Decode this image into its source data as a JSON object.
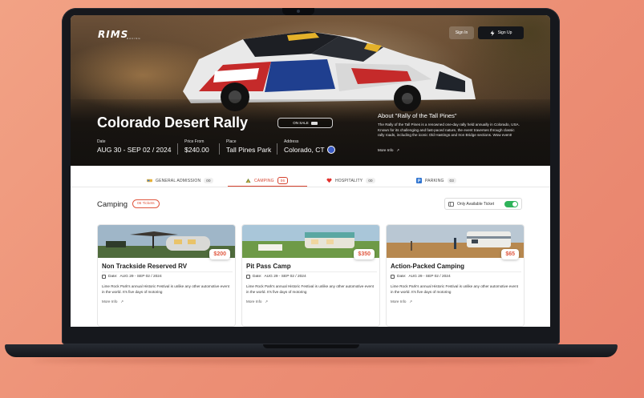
{
  "header": {
    "logo_text": "RIMS",
    "logo_sub": "RACING",
    "signin_label": "Sign In",
    "signup_label": "Sign Up"
  },
  "event": {
    "title": "Colorado Desert Rally",
    "status_badge": "ON SALE",
    "date_label": "Date",
    "date_value": "AUG 30 - SEP 02 / 2024",
    "price_label": "Price From",
    "price_value": "$240.00",
    "place_label": "Place",
    "place_value": "Tall Pines Park",
    "address_label": "Address",
    "address_value": "Colorado, CT"
  },
  "about": {
    "title": "About \"Rally of the Tall Pines\"",
    "text": "The Rally of the Tall Pines is a renowned one-day rally held annually in Colorado, USA. Known for its challenging and fast-paced nature, the event traverses through classic rally roads, including the iconic Old Hastings and Iron Bridge sections. Wow event!",
    "more_label": "More Info"
  },
  "tabs": [
    {
      "label": "GENERAL ADMISSION",
      "count": "00",
      "icon": "ticket-icon"
    },
    {
      "label": "CAMPING",
      "count": "06",
      "icon": "tent-icon"
    },
    {
      "label": "HOSPITALITY",
      "count": "00",
      "icon": "heart-icon"
    },
    {
      "label": "PARKING",
      "count": "03",
      "icon": "parking-icon"
    }
  ],
  "section": {
    "title": "Camping",
    "tickets_badge": "06 Tickets",
    "filter_label": "Only Available Ticket",
    "filter_on": true
  },
  "cards": [
    {
      "title": "Non Trackside Reserved RV",
      "price": "$200",
      "date_label": "Date:",
      "date": "AUG 29 - SEP 02 / 2024",
      "desc": "Lime Rock Park's annual Historic Festival is unlike any other automotive event in the world. It's five days of motoring",
      "more": "More Info"
    },
    {
      "title": "Pit Pass Camp",
      "price": "$350",
      "date_label": "Date:",
      "date": "AUG 29 - SEP 02 / 2024",
      "desc": "Lime Rock Park's annual Historic Festival is unlike any other automotive event in the world. It's five days of motoring",
      "more": "More Info"
    },
    {
      "title": "Action-Packed Camping",
      "price": "$65",
      "date_label": "Date:",
      "date": "AUG 29 - SEP 02 / 2024",
      "desc": "Lime Rock Park's annual Historic Festival is unlike any other automotive event in the world. It's five days of motoring",
      "more": "More Info"
    }
  ],
  "colors": {
    "accent": "#d6422e",
    "price": "#e0573f",
    "toggle_on": "#2fb35a",
    "background": "#ec8f75"
  }
}
